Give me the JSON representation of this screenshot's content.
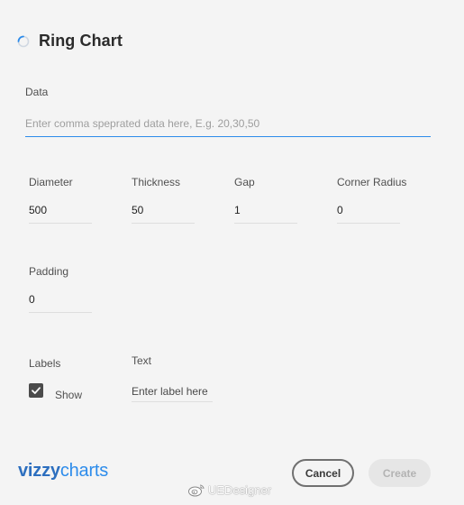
{
  "header": {
    "title": "Ring Chart"
  },
  "data_field": {
    "label": "Data",
    "value": "",
    "placeholder": "Enter comma speprated data here, E.g. 20,30,50"
  },
  "fields": {
    "diameter": {
      "label": "Diameter",
      "value": "500"
    },
    "thickness": {
      "label": "Thickness",
      "value": "50"
    },
    "gap": {
      "label": "Gap",
      "value": "1"
    },
    "corner_radius": {
      "label": "Corner Radius",
      "value": "0"
    },
    "padding": {
      "label": "Padding",
      "value": "0"
    }
  },
  "labels": {
    "label": "Labels",
    "checkbox_label": "Show",
    "checked": true
  },
  "text_field": {
    "label": "Text",
    "value": "",
    "placeholder": "Enter label here"
  },
  "footer": {
    "logo_bold": "vizzy",
    "logo_light": "charts",
    "cancel_label": "Cancel",
    "create_label": "Create",
    "watermark": "UEDesigner"
  },
  "colors": {
    "accent": "#2d8ceb",
    "logo": "#2d6fbf",
    "background": "#f4f4f4",
    "checkbox": "#4b4b4b"
  },
  "icons": {
    "spinner": "spinner-icon",
    "checkbox": "check-icon",
    "watermark": "weibo-icon"
  }
}
